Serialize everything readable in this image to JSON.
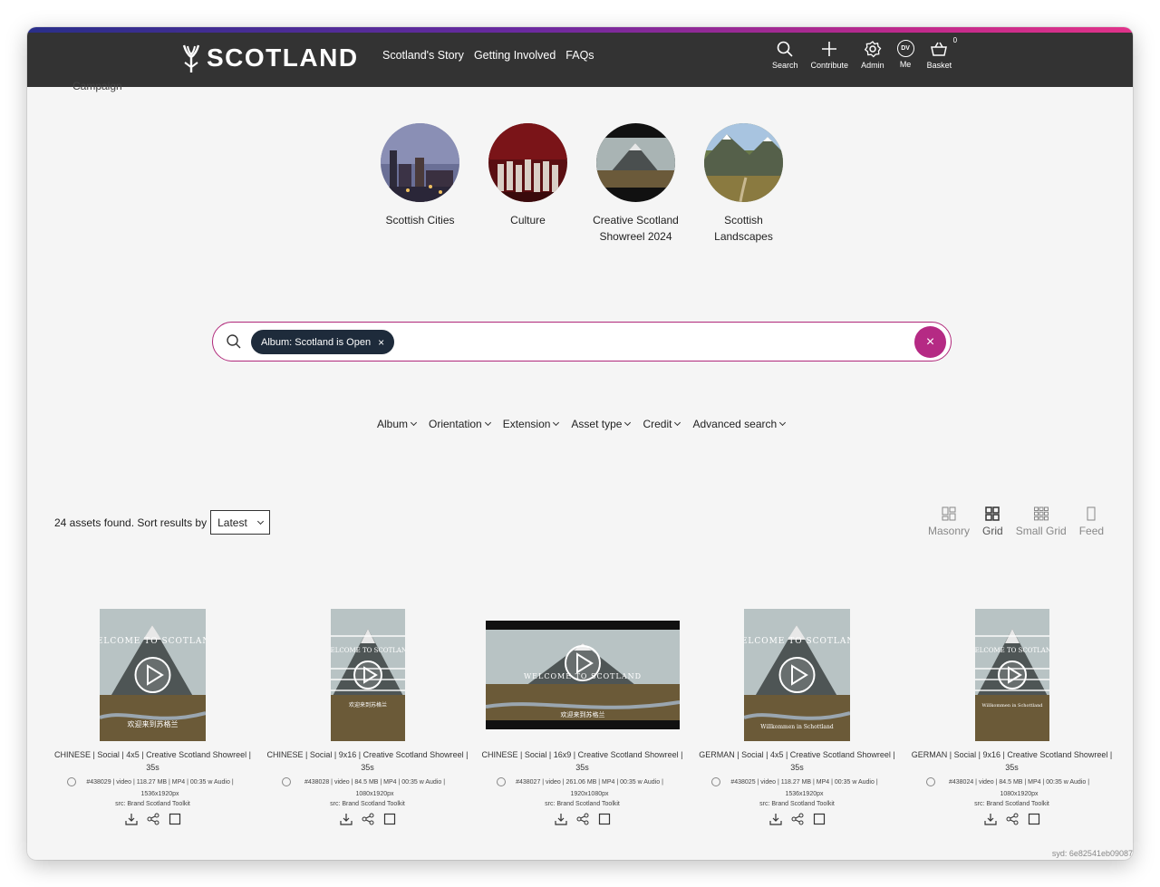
{
  "colors": {
    "header_bg": "#333333",
    "accent": "#b52a84",
    "chip_bg": "#1e2b3b"
  },
  "header": {
    "logo_text": "SCOTLAND",
    "nav": [
      "Scotland's Story",
      "Getting Involved",
      "FAQs"
    ],
    "tools": [
      {
        "label": "Search",
        "icon": "search-icon"
      },
      {
        "label": "Contribute",
        "icon": "plus-icon"
      },
      {
        "label": "Admin",
        "icon": "gear-icon"
      },
      {
        "label": "Me",
        "icon": "avatar-icon",
        "initials": "DV"
      },
      {
        "label": "Basket",
        "icon": "basket-icon",
        "badge": "0"
      }
    ]
  },
  "campaign_label": "Campaign",
  "albums": [
    {
      "label": "Scottish Cities"
    },
    {
      "label": "Culture"
    },
    {
      "label": "Creative Scotland Showreel 2024"
    },
    {
      "label": "Scottish Landscapes"
    }
  ],
  "search": {
    "chip": "Album: Scotland is Open",
    "chip_close": "×",
    "clear": "×"
  },
  "filters": [
    "Album",
    "Orientation",
    "Extension",
    "Asset type",
    "Credit",
    "Advanced search"
  ],
  "results": {
    "count_text": "24 assets found. Sort results by",
    "sort_value": "Latest"
  },
  "views": [
    {
      "label": "Masonry",
      "icon": "masonry-icon"
    },
    {
      "label": "Grid",
      "icon": "grid-icon",
      "active": true
    },
    {
      "label": "Small Grid",
      "icon": "small-grid-icon"
    },
    {
      "label": "Feed",
      "icon": "feed-icon"
    }
  ],
  "assets": [
    {
      "title": "CHINESE | Social | 4x5 | Creative Scotland Showreel | 35s",
      "meta": "#438029 | video | 118.27 MB | MP4 | 00:35 w Audio | 1536x1920px",
      "src": "src: Brand Scotland Toolkit",
      "overlay": "WELCOME TO SCOTLAND",
      "subtitle": "欢迎来到苏格兰"
    },
    {
      "title": "CHINESE | Social | 9x16 | Creative Scotland Showreel | 35s",
      "meta": "#438028 | video | 84.5 MB | MP4 | 00:35 w Audio | 1080x1920px",
      "src": "src: Brand Scotland Toolkit",
      "overlay": "WELCOME TO SCOTLAND",
      "subtitle": "欢迎来到苏格兰"
    },
    {
      "title": "CHINESE | Social | 16x9 | Creative Scotland Showreel | 35s",
      "meta": "#438027 | video | 261.06 MB | MP4 | 00:35 w Audio | 1920x1080px",
      "src": "src: Brand Scotland Toolkit",
      "overlay": "WELCOME TO SCOTLAND",
      "subtitle": "欢迎来到苏格兰"
    },
    {
      "title": "GERMAN | Social | 4x5 | Creative Scotland Showreel | 35s",
      "meta": "#438025 | video | 118.27 MB | MP4 | 00:35 w Audio | 1536x1920px",
      "src": "src: Brand Scotland Toolkit",
      "overlay": "WELCOME TO SCOTLAND",
      "subtitle": "Willkommen in Schottland"
    },
    {
      "title": "GERMAN | Social | 9x16 | Creative Scotland Showreel | 35s",
      "meta": "#438024 | video | 84.5 MB | MP4 | 00:35 w Audio | 1080x1920px",
      "src": "src: Brand Scotland Toolkit",
      "overlay": "WELCOME TO SCOTLAND",
      "subtitle": "Willkommen in Schottland"
    }
  ],
  "footer_id": "syd: 6e82541eb09087"
}
